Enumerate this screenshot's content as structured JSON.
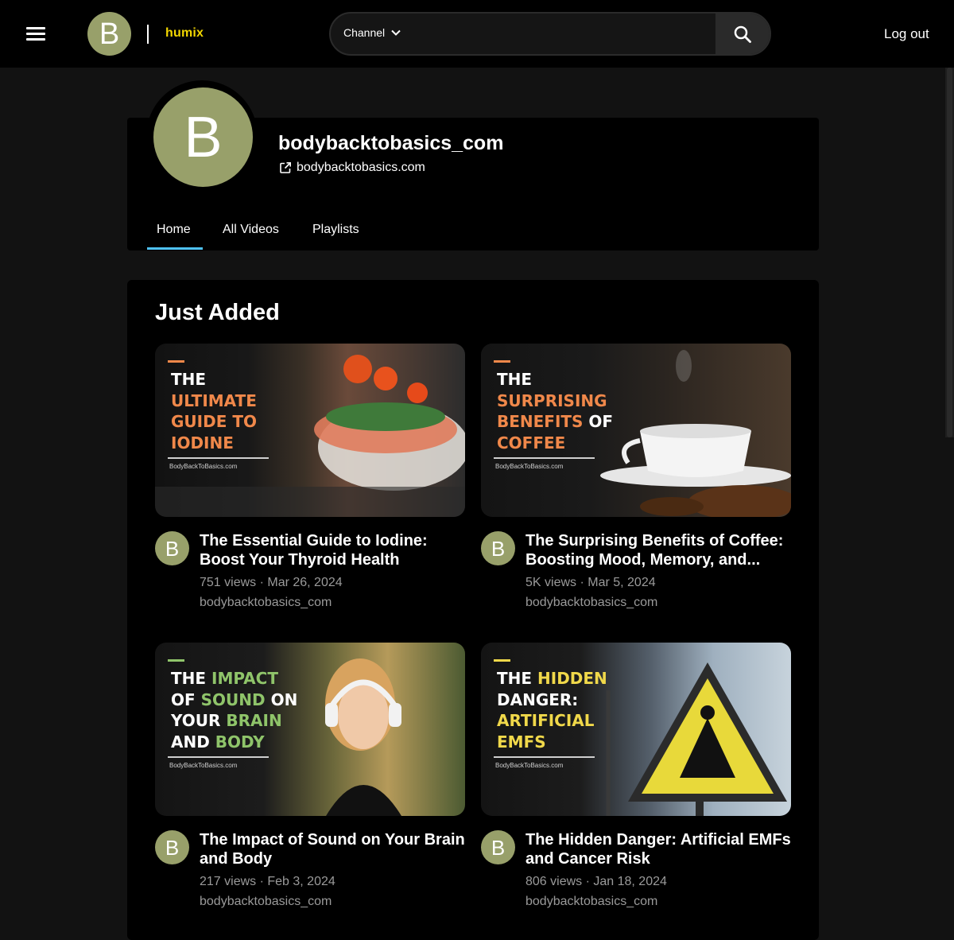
{
  "header": {
    "menu_icon": "hamburger-menu-icon",
    "avatar_letter": "B",
    "brand": "humix",
    "search": {
      "scope": "Channel",
      "placeholder": "",
      "value": ""
    },
    "logout_label": "Log out"
  },
  "channel": {
    "avatar_letter": "B",
    "name": "bodybacktobasics_com",
    "link": "bodybacktobasics.com",
    "tabs": [
      {
        "label": "Home",
        "active": true
      },
      {
        "label": "All Videos",
        "active": false
      },
      {
        "label": "Playlists",
        "active": false
      }
    ]
  },
  "section": {
    "title": "Just Added"
  },
  "videos": [
    {
      "avatar_letter": "B",
      "title": "The Essential Guide to Iodine: Boost Your Thyroid Health",
      "meta": "751 views · Mar 26, 2024",
      "channel": "bodybacktobasics_com",
      "thumb_lines": [
        "THE",
        "ULTIMATE",
        "GUIDE TO",
        "IODINE"
      ],
      "thumb_domain": "BodyBackToBasics.com",
      "accent": "#f0884a"
    },
    {
      "avatar_letter": "B",
      "title": "The Surprising Benefits of Coffee: Boosting Mood, Memory, and...",
      "meta": "5K views · Mar 5, 2024",
      "channel": "bodybacktobasics_com",
      "thumb_lines": [
        "THE",
        "SURPRISING",
        "BENEFITS OF",
        "COFFEE"
      ],
      "thumb_domain": "BodyBackToBasics.com",
      "accent": "#f0884a"
    },
    {
      "avatar_letter": "B",
      "title": "The Impact of Sound on Your Brain and Body",
      "meta": "217 views · Feb 3, 2024",
      "channel": "bodybacktobasics_com",
      "thumb_lines": [
        "THE IMPACT",
        "OF SOUND ON",
        "YOUR BRAIN",
        "AND BODY"
      ],
      "thumb_domain": "BodyBackToBasics.com",
      "accent": "#8fc46a"
    },
    {
      "avatar_letter": "B",
      "title": "The Hidden Danger: Artificial EMFs and Cancer Risk",
      "meta": "806 views · Jan 18, 2024",
      "channel": "bodybacktobasics_com",
      "thumb_lines": [
        "THE HIDDEN",
        "DANGER:",
        "ARTIFICIAL",
        "EMFS"
      ],
      "thumb_domain": "BodyBackToBasics.com",
      "accent": "#f0d84a"
    }
  ],
  "colors": {
    "background": "#121212",
    "card": "#000000",
    "avatar": "#98a06a",
    "brand": "#f2d600",
    "tab_underline": "#4fc3f7",
    "muted_text": "#9a9a9a"
  }
}
